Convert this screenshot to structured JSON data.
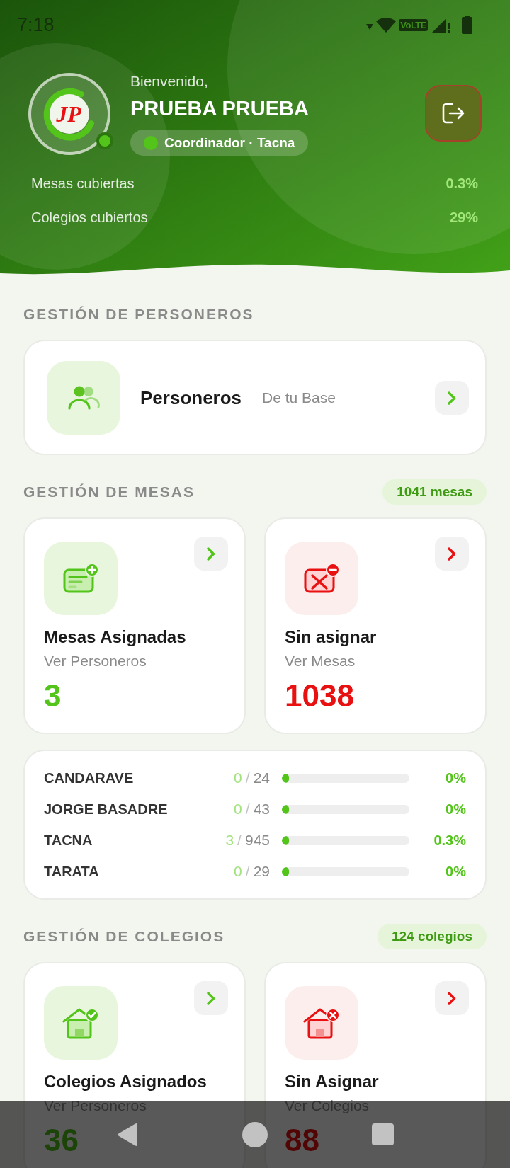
{
  "status_bar": {
    "time": "7:18",
    "network_type": "VoLTE"
  },
  "header": {
    "avatar": {
      "logo_text": "JP",
      "online": true
    },
    "greeting": "Bienvenido,",
    "name": "PRUEBA PRUEBA",
    "role": "Coordinador · Tacna",
    "stats": [
      {
        "label": "Mesas cubiertas",
        "value": "0.3%"
      },
      {
        "label": "Colegios cubiertos",
        "value": "29%"
      }
    ]
  },
  "sections": [
    {
      "kind": "personeros",
      "title": "GESTIÓN DE PERSONEROS",
      "cards": [
        {
          "title": "Personeros",
          "subtitle": "De tu Base"
        }
      ]
    },
    {
      "kind": "mesas",
      "title": "GESTIÓN DE MESAS",
      "badge": "1041 mesas",
      "cards": [
        {
          "kind": "assigned",
          "title": "Mesas Asignadas",
          "subtitle": "Ver Personeros",
          "count": "3"
        },
        {
          "kind": "unassigned",
          "title": "Sin asignar",
          "subtitle": "Ver Mesas",
          "count": "1038"
        }
      ],
      "breakdown": [
        {
          "name": "CANDARAVE",
          "assigned": "0",
          "separator": "/",
          "total": "24",
          "level": 0,
          "percent": "0%"
        },
        {
          "name": "JORGE BASADRE",
          "assigned": "0",
          "separator": "/",
          "total": "43",
          "level": 0,
          "percent": "0%"
        },
        {
          "name": "TACNA",
          "assigned": "3",
          "separator": "/",
          "total": "945",
          "level": 0.003,
          "percent": "0.3%"
        },
        {
          "name": "TARATA",
          "assigned": "0",
          "separator": "/",
          "total": "29",
          "level": 0,
          "percent": "0%"
        }
      ]
    },
    {
      "kind": "colegios",
      "title": "GESTIÓN DE COLEGIOS",
      "badge": "124 colegios",
      "cards": [
        {
          "kind": "assigned",
          "title": "Colegios Asignados",
          "subtitle": "Ver Personeros",
          "count": "36"
        },
        {
          "kind": "unassigned",
          "title": "Sin Asignar",
          "subtitle": "Ver Colegios",
          "count": "88"
        }
      ]
    }
  ]
}
